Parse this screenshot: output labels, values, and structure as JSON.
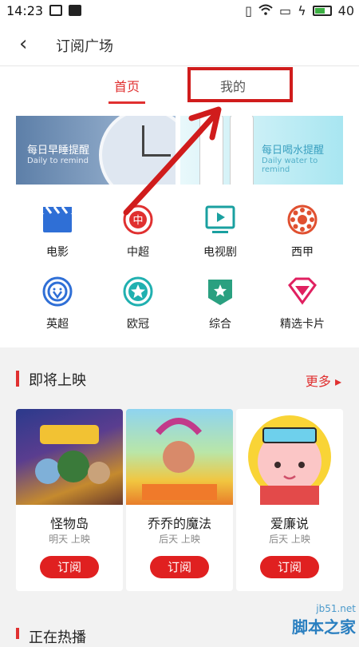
{
  "status_bar": {
    "time": "14:23",
    "battery": "40"
  },
  "header": {
    "title": "订阅广场"
  },
  "tabs": [
    {
      "label": "首页"
    },
    {
      "label": "我的"
    }
  ],
  "banners": [
    {
      "title": "每日早睡提醒",
      "subtitle": "Daily to remind"
    },
    {
      "title": "每日喝水提醒",
      "subtitle": "Daily water to remind"
    }
  ],
  "categories": [
    {
      "label": "电影",
      "icon": "film-icon",
      "color": "#2f6fd6"
    },
    {
      "label": "中超",
      "icon": "csl-icon",
      "color": "#e03030"
    },
    {
      "label": "电视剧",
      "icon": "tv-icon",
      "color": "#1aa0a0"
    },
    {
      "label": "西甲",
      "icon": "laliga-icon",
      "color": "#e05030"
    },
    {
      "label": "英超",
      "icon": "lion-icon",
      "color": "#2f6fd6"
    },
    {
      "label": "欧冠",
      "icon": "star-icon",
      "color": "#20b0b0"
    },
    {
      "label": "综合",
      "icon": "shield-star-icon",
      "color": "#2aa080"
    },
    {
      "label": "精选卡片",
      "icon": "diamond-icon",
      "color": "#e02060"
    }
  ],
  "upcoming": {
    "title": "即将上映",
    "more_label": "更多",
    "items": [
      {
        "name": "怪物岛",
        "when": "明天 上映",
        "button": "订阅"
      },
      {
        "name": "乔乔的魔法",
        "when": "后天 上映",
        "button": "订阅"
      },
      {
        "name": "爱廉说",
        "when": "后天 上映",
        "button": "订阅"
      }
    ]
  },
  "next_section": {
    "title": "正在热播"
  },
  "watermark": {
    "line1": "jb51.net",
    "line2": "脚本之家"
  }
}
